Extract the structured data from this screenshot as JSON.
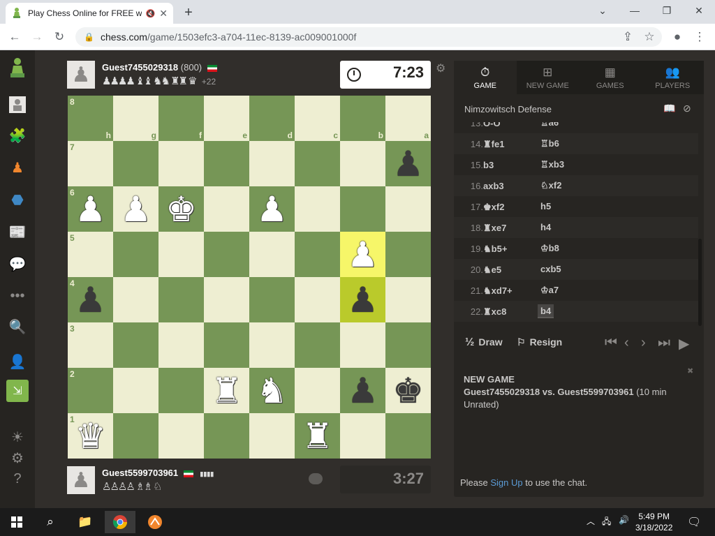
{
  "browser": {
    "tab_title": "Play Chess Online for FREE w",
    "url_host": "chess.com",
    "url_path": "/game/1503efc3-a704-11ec-8139-ac009001000f"
  },
  "top_player": {
    "name": "Guest7455029318",
    "rating": "(800)",
    "captured": "♟♟♟♟ ♝♝ ♞♞ ♜♜ ♛",
    "advantage": "+22",
    "clock": "7:23"
  },
  "bottom_player": {
    "name": "Guest5599703961",
    "captured_row1": "▮▮▮▮",
    "captured_row2": "♙♙♙♙ ♗♗ ♘",
    "clock": "3:27"
  },
  "board": {
    "ranks": [
      "8",
      "7",
      "6",
      "5",
      "4",
      "3",
      "2",
      "1"
    ],
    "files": [
      "h",
      "g",
      "f",
      "e",
      "d",
      "c",
      "b",
      "a"
    ],
    "pieces": [
      {
        "r": 0,
        "f": 0,
        "p": "♛",
        "c": "w"
      },
      {
        "r": 0,
        "f": 5,
        "p": "♜",
        "c": "w"
      },
      {
        "r": 1,
        "f": 3,
        "p": "♜",
        "c": "w"
      },
      {
        "r": 1,
        "f": 4,
        "p": "♞",
        "c": "w"
      },
      {
        "r": 1,
        "f": 6,
        "p": "♟",
        "c": "b"
      },
      {
        "r": 1,
        "f": 7,
        "p": "♚",
        "c": "b"
      },
      {
        "r": 3,
        "f": 0,
        "p": "♟",
        "c": "b"
      },
      {
        "r": 3,
        "f": 6,
        "p": "♟",
        "c": "b"
      },
      {
        "r": 4,
        "f": 6,
        "p": "♟",
        "c": "w"
      },
      {
        "r": 5,
        "f": 0,
        "p": "♟",
        "c": "w"
      },
      {
        "r": 5,
        "f": 1,
        "p": "♟",
        "c": "w"
      },
      {
        "r": 5,
        "f": 2,
        "p": "♚",
        "c": "w"
      },
      {
        "r": 5,
        "f": 4,
        "p": "♟",
        "c": "w"
      },
      {
        "r": 6,
        "f": 7,
        "p": "♟",
        "c": "b"
      }
    ],
    "highlight": [
      {
        "r": 3,
        "f": 6
      },
      {
        "r": 4,
        "f": 6
      }
    ]
  },
  "panel": {
    "tabs": [
      {
        "label": "GAME",
        "icon": "⏱"
      },
      {
        "label": "NEW GAME",
        "icon": "⊞"
      },
      {
        "label": "GAMES",
        "icon": "▦"
      },
      {
        "label": "PLAYERS",
        "icon": "👥"
      }
    ],
    "opening": "Nimzowitsch Defense",
    "moves": [
      {
        "n": "13.",
        "w": "O-O",
        "b": "♖a6"
      },
      {
        "n": "14.",
        "w": "♜fe1",
        "b": "♖b6"
      },
      {
        "n": "15.",
        "w": "b3",
        "b": "♖xb3"
      },
      {
        "n": "16.",
        "w": "axb3",
        "b": "♘xf2"
      },
      {
        "n": "17.",
        "w": "♚xf2",
        "b": "h5"
      },
      {
        "n": "18.",
        "w": "♜xe7",
        "b": "h4"
      },
      {
        "n": "19.",
        "w": "♞b5+",
        "b": "♔b8"
      },
      {
        "n": "20.",
        "w": "♞e5",
        "b": "cxb5"
      },
      {
        "n": "21.",
        "w": "♞xd7+",
        "b": "♔a7"
      },
      {
        "n": "22.",
        "w": "♜xc8",
        "b": "b4"
      }
    ],
    "draw_label": "Draw",
    "draw_prefix": "½",
    "resign_label": "Resign",
    "game_heading": "NEW GAME",
    "game_players": "Guest7455029318 vs. Guest5599703961",
    "game_desc": "(10 min Unrated)",
    "chat_prefix": "Please ",
    "chat_link": "Sign Up",
    "chat_suffix": " to use the chat."
  },
  "taskbar": {
    "time": "5:49 PM",
    "date": "3/18/2022"
  }
}
